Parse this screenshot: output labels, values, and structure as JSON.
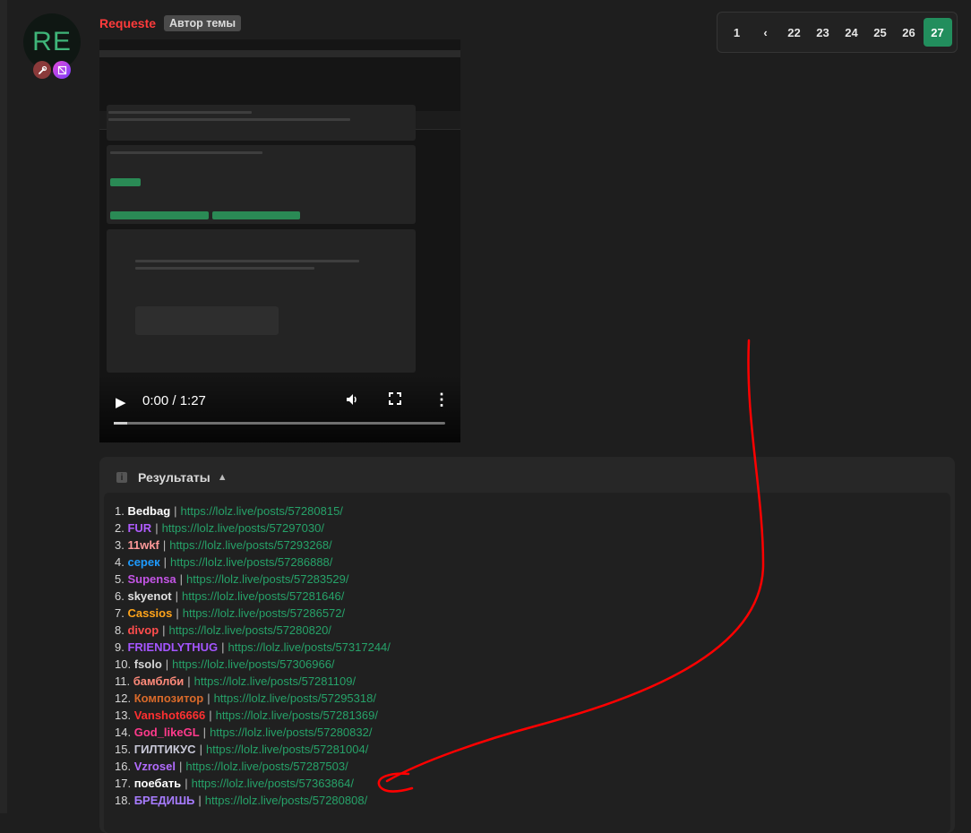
{
  "post": {
    "avatar_initials": "RE",
    "username": "Requeste",
    "author_badge": "Автор темы"
  },
  "pagination": {
    "pages": [
      "1",
      "‹",
      "22",
      "23",
      "24",
      "25",
      "26",
      "27"
    ],
    "current": "27"
  },
  "video": {
    "time": "0:00 / 1:27",
    "progress_percent": 4
  },
  "results": {
    "title": "Результаты",
    "items": [
      {
        "num": "1.",
        "name": "Bedbag",
        "color": "#ffffff",
        "url": "https://lolz.live/posts/57280815/"
      },
      {
        "num": "2.",
        "name": "FUR",
        "color": "#b05cff",
        "url": "https://lolz.live/posts/57297030/"
      },
      {
        "num": "3.",
        "name": "11wkf",
        "color": "#ff9a9a",
        "url": "https://lolz.live/posts/57293268/"
      },
      {
        "num": "4.",
        "name": "серек",
        "color": "#1e9bff",
        "url": "https://lolz.live/posts/57286888/"
      },
      {
        "num": "5.",
        "name": "Supensa",
        "color": "#c455e6",
        "url": "https://lolz.live/posts/57283529/"
      },
      {
        "num": "6.",
        "name": "skyenot",
        "color": "#e0e0e0",
        "url": "https://lolz.live/posts/57281646/"
      },
      {
        "num": "7.",
        "name": "Cassios",
        "color": "#ffa41a",
        "url": "https://lolz.live/posts/57286572/"
      },
      {
        "num": "8.",
        "name": "divop",
        "color": "#ff4d4d",
        "url": "https://lolz.live/posts/57280820/"
      },
      {
        "num": "9.",
        "name": "FRIENDLYTHUG",
        "color": "#a455ff",
        "url": "https://lolz.live/posts/57317244/"
      },
      {
        "num": "10.",
        "name": "fsolo",
        "color": "#d6d6d6",
        "url": "https://lolz.live/posts/57306966/"
      },
      {
        "num": "11.",
        "name": "бамблби",
        "color": "#ff8a7a",
        "url": "https://lolz.live/posts/57281109/"
      },
      {
        "num": "12.",
        "name": "Композитор",
        "color": "#d96a2a",
        "url": "https://lolz.live/posts/57295318/"
      },
      {
        "num": "13.",
        "name": "Vanshot6666",
        "color": "#ff3030",
        "url": "https://lolz.live/posts/57281369/"
      },
      {
        "num": "14.",
        "name": "God_likeGL",
        "color": "#ff3a8c",
        "url": "https://lolz.live/posts/57280832/"
      },
      {
        "num": "15.",
        "name": "ГИЛТИКУС",
        "color": "#c9c9d9",
        "url": "https://lolz.live/posts/57281004/"
      },
      {
        "num": "16.",
        "name": "Vzrosel",
        "color": "#b26cff",
        "url": "https://lolz.live/posts/57287503/"
      },
      {
        "num": "17.",
        "name": "поебать",
        "color": "#ffffff",
        "url": "https://lolz.live/posts/57363864/"
      },
      {
        "num": "18.",
        "name": "БРЕДИШЬ",
        "color": "#a77cff",
        "url": "https://lolz.live/posts/57280808/"
      }
    ]
  },
  "colors": {
    "accent_green": "#228e5d",
    "link_green": "#26a269",
    "annotation_red": "#ff0000"
  }
}
